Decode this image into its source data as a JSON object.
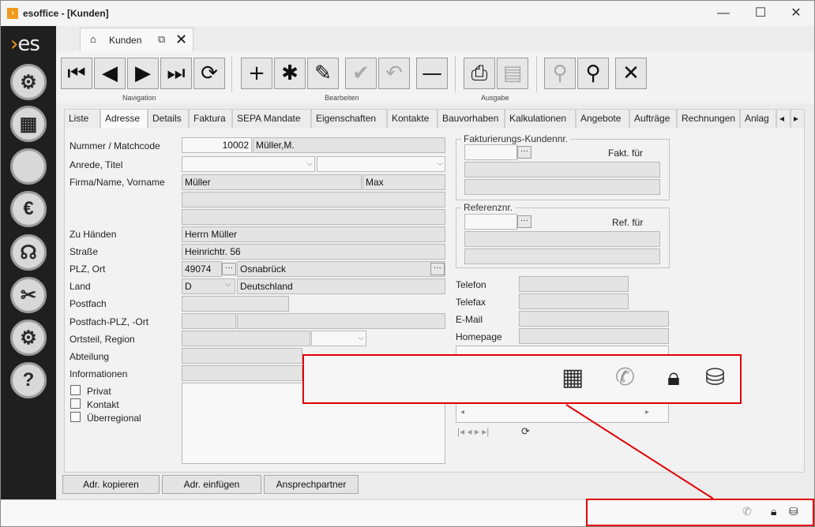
{
  "window": {
    "title": "esoffice - [Kunden]",
    "minimize": "—",
    "maximize": "☐",
    "close": "✕"
  },
  "sidebar": {
    "logo_mark": "›",
    "logo_text": "es",
    "items": [
      {
        "icon": "gear-icon",
        "glyph": "⚙"
      },
      {
        "icon": "building-grid-icon",
        "glyph": "▦"
      },
      {
        "icon": "blank-icon",
        "glyph": ""
      },
      {
        "icon": "euro-icon",
        "glyph": "€"
      },
      {
        "icon": "headset-icon",
        "glyph": "☊"
      },
      {
        "icon": "tools-icon",
        "glyph": "✂"
      },
      {
        "icon": "settings-gears-icon",
        "glyph": "⚙"
      },
      {
        "icon": "help-icon",
        "glyph": "?"
      }
    ]
  },
  "doc_tab": {
    "home_icon": "⌂",
    "label": "Kunden",
    "external_icon": "⧉",
    "close_icon": "✕"
  },
  "toolbar": {
    "groups": {
      "navigation": "Navigation",
      "edit": "Bearbeiten",
      "output": "Ausgabe"
    },
    "buttons": {
      "first": "⏮",
      "prev": "◀",
      "next": "▶",
      "last": "⏭",
      "refresh": "⟳",
      "add": "+",
      "new": "✱",
      "edit": "✎",
      "save": "✔",
      "undo": "↶",
      "delete": "—",
      "print": "⎙",
      "preview": "▤",
      "walk1": "⚲",
      "walk2": "⚲",
      "cancel": "✕"
    }
  },
  "tabs": [
    "Liste",
    "Adresse",
    "Details",
    "Faktura",
    "SEPA Mandate",
    "Eigenschaften",
    "Kontakte",
    "Bauvorhaben",
    "Kalkulationen",
    "Angebote",
    "Aufträge",
    "Rechnungen",
    "Anlag"
  ],
  "tab_scroll": {
    "left": "◂",
    "right": "▸"
  },
  "form": {
    "labels": {
      "nummer": "Nummer / Matchcode",
      "anrede": "Anrede, Titel",
      "firma": "Firma/Name, Vorname",
      "zuhaenden": "Zu Händen",
      "strasse": "Straße",
      "plzort": "PLZ, Ort",
      "land": "Land",
      "postfach": "Postfach",
      "postfachplz": "Postfach-PLZ, -Ort",
      "ortsteil": "Ortsteil, Region",
      "abteilung": "Abteilung",
      "informationen": "Informationen",
      "privat": "Privat",
      "kontakt": "Kontakt",
      "ueberregional": "Überregional",
      "telefon": "Telefon",
      "telefax": "Telefax",
      "email": "E-Mail",
      "homepage": "Homepage"
    },
    "values": {
      "nummer": "10002",
      "matchcode": "Müller,M.",
      "name": "Müller",
      "vorname": "Max",
      "zuhaenden": "Herrn Müller",
      "strasse": "Heinrichtr. 56",
      "plz": "49074",
      "ort": "Osnabrück",
      "land_code": "D",
      "land_name": "Deutschland"
    },
    "faktura_group": {
      "legend": "Fakturierungs-Kundennr.",
      "label": "Fakt. für"
    },
    "referenz_group": {
      "legend": "Referenznr.",
      "label": "Ref. für"
    }
  },
  "bottom_buttons": [
    "Adr. kopieren",
    "Adr. einfügen",
    "Ansprechpartner"
  ],
  "status_icons": {
    "building": "building-sync-icon",
    "phone": "phone-icon",
    "lock": "lock-icon",
    "database": "database-icon"
  },
  "colors": {
    "accent": "#f29a1f",
    "highlight": "#e20000",
    "sidebar": "#1f1f1f"
  }
}
